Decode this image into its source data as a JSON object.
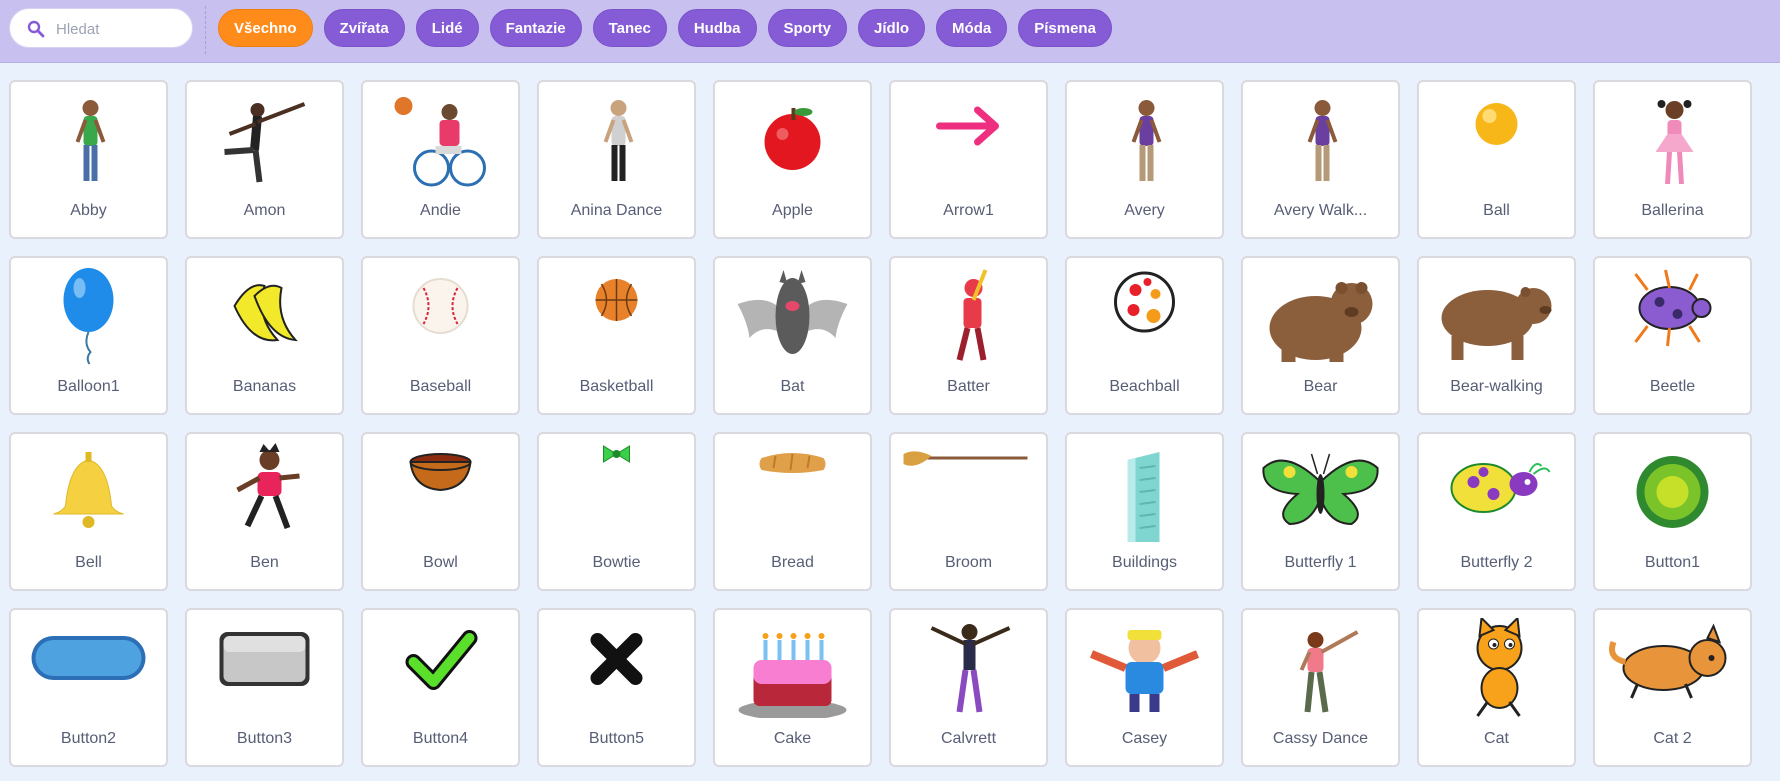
{
  "search": {
    "placeholder": "Hledat",
    "value": "",
    "icon": "search-icon"
  },
  "categories": [
    {
      "label": "Všechno",
      "active": true
    },
    {
      "label": "Zvířata"
    },
    {
      "label": "Lidé"
    },
    {
      "label": "Fantazie"
    },
    {
      "label": "Tanec"
    },
    {
      "label": "Hudba"
    },
    {
      "label": "Sporty"
    },
    {
      "label": "Jídlo"
    },
    {
      "label": "Móda"
    },
    {
      "label": "Písmena"
    }
  ],
  "colors": {
    "accent": "#855cd6",
    "active": "#ff8c1a",
    "topbar": "#c8c1ef",
    "background": "#e9f1fc"
  },
  "sprites": [
    {
      "name": "Abby",
      "icon": "girl-standing-icon"
    },
    {
      "name": "Amon",
      "icon": "dancer-man-icon"
    },
    {
      "name": "Andie",
      "icon": "wheelchair-basketball-icon"
    },
    {
      "name": "Anina Dance",
      "icon": "dancer-woman-icon"
    },
    {
      "name": "Apple",
      "icon": "apple-icon"
    },
    {
      "name": "Arrow1",
      "icon": "arrow-icon"
    },
    {
      "name": "Avery",
      "icon": "girl-standing-icon"
    },
    {
      "name": "Avery Walk...",
      "icon": "girl-walking-icon"
    },
    {
      "name": "Ball",
      "icon": "ball-icon"
    },
    {
      "name": "Ballerina",
      "icon": "ballerina-icon"
    },
    {
      "name": "Balloon1",
      "icon": "balloon-icon"
    },
    {
      "name": "Bananas",
      "icon": "bananas-icon"
    },
    {
      "name": "Baseball",
      "icon": "baseball-icon"
    },
    {
      "name": "Basketball",
      "icon": "basketball-icon"
    },
    {
      "name": "Bat",
      "icon": "bat-icon"
    },
    {
      "name": "Batter",
      "icon": "batter-icon"
    },
    {
      "name": "Beachball",
      "icon": "beachball-icon"
    },
    {
      "name": "Bear",
      "icon": "bear-icon"
    },
    {
      "name": "Bear-walking",
      "icon": "bear-walking-icon"
    },
    {
      "name": "Beetle",
      "icon": "beetle-icon"
    },
    {
      "name": "Bell",
      "icon": "bell-icon"
    },
    {
      "name": "Ben",
      "icon": "boy-running-icon"
    },
    {
      "name": "Bowl",
      "icon": "bowl-icon"
    },
    {
      "name": "Bowtie",
      "icon": "bowtie-icon"
    },
    {
      "name": "Bread",
      "icon": "bread-icon"
    },
    {
      "name": "Broom",
      "icon": "broom-icon"
    },
    {
      "name": "Buildings",
      "icon": "building-icon"
    },
    {
      "name": "Butterfly 1",
      "icon": "butterfly-icon"
    },
    {
      "name": "Butterfly 2",
      "icon": "butterfly-icon"
    },
    {
      "name": "Button1",
      "icon": "round-button-icon"
    },
    {
      "name": "Button2",
      "icon": "pill-button-icon"
    },
    {
      "name": "Button3",
      "icon": "square-button-icon"
    },
    {
      "name": "Button4",
      "icon": "checkmark-icon"
    },
    {
      "name": "Button5",
      "icon": "x-mark-icon"
    },
    {
      "name": "Cake",
      "icon": "cake-icon"
    },
    {
      "name": "Calvrett",
      "icon": "dancer-man-icon"
    },
    {
      "name": "Casey",
      "icon": "character-icon"
    },
    {
      "name": "Cassy Dance",
      "icon": "dancer-woman-icon"
    },
    {
      "name": "Cat",
      "icon": "cat-icon"
    },
    {
      "name": "Cat 2",
      "icon": "cat-lying-icon"
    }
  ]
}
